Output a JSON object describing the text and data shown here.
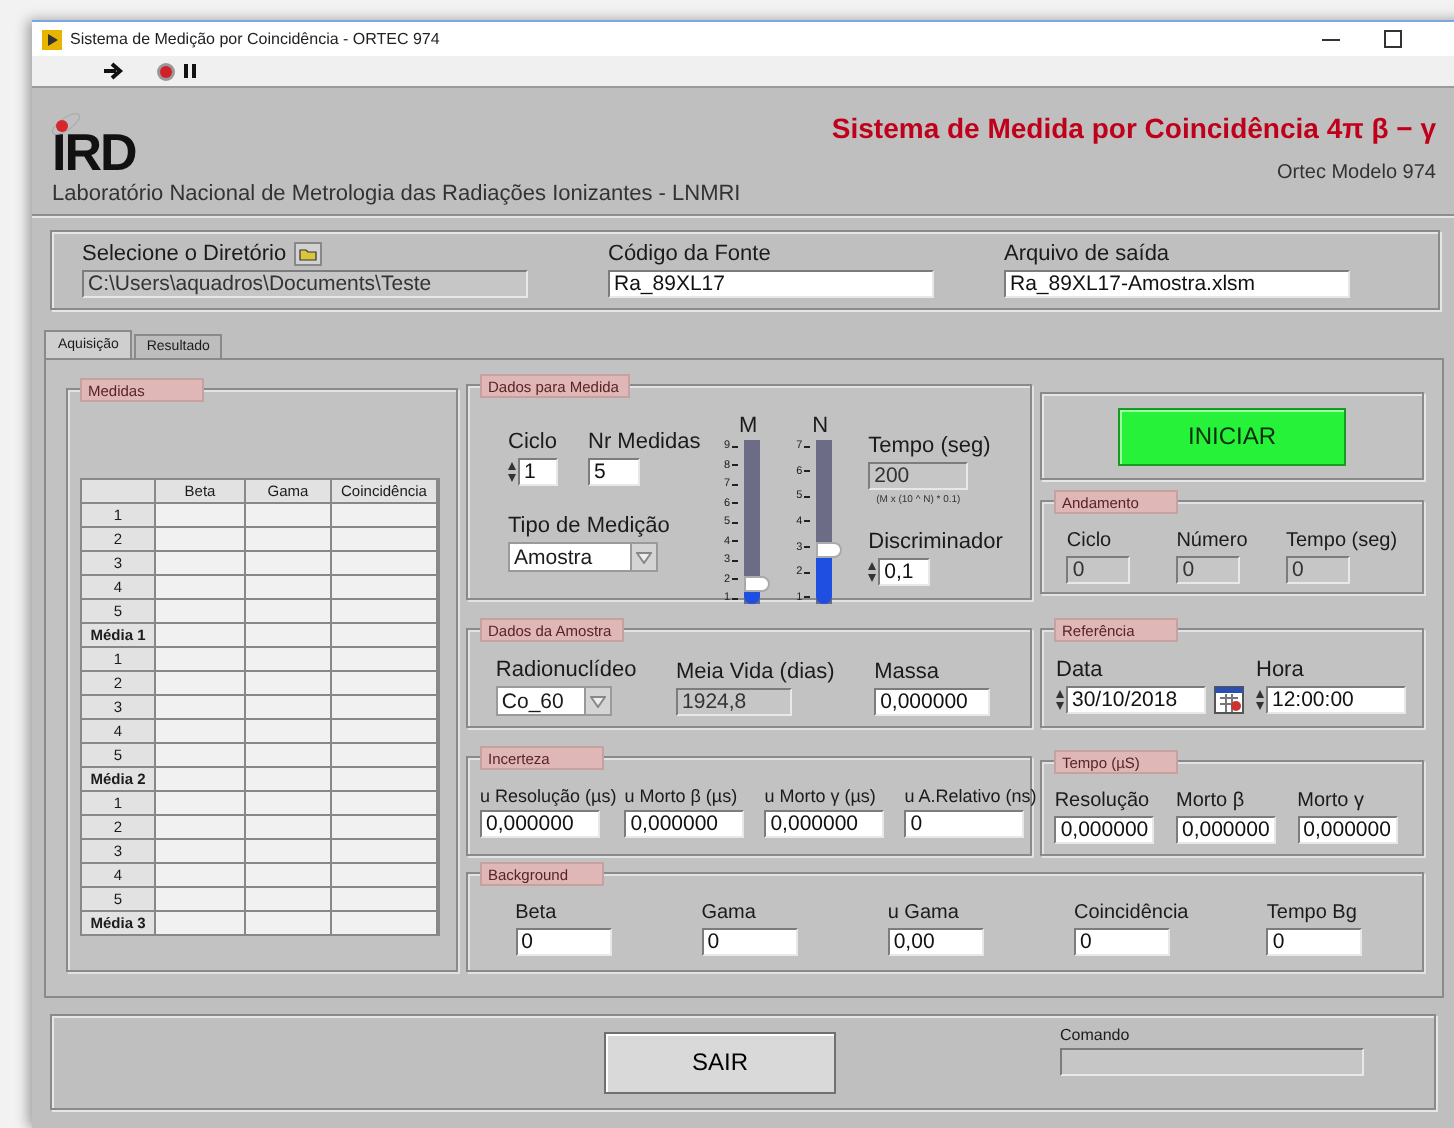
{
  "window": {
    "title": "Sistema de Medição por Coincidência - ORTEC 974"
  },
  "header": {
    "logo": "IRD",
    "lab": "Laboratório Nacional de Metrologia das Radiações Ionizantes - LNMRI",
    "title": "Sistema de Medida por Coincidência 4π β − γ",
    "subtitle": "Ortec Modelo 974"
  },
  "files": {
    "directory": {
      "label": "Selecione o Diretório",
      "value": "C:\\Users\\aquadros\\Documents\\Teste",
      "kind": "readout"
    },
    "source": {
      "label": "Código da Fonte",
      "value": "Ra_89XL17",
      "kind": "input"
    },
    "output": {
      "label": "Arquivo de saída",
      "value": "Ra_89XL17-Amostra.xlsm",
      "kind": "input"
    }
  },
  "tabs": [
    {
      "label": "Aquisição",
      "selected": true
    },
    {
      "label": "Resultado",
      "selected": false
    }
  ],
  "medidas": {
    "title": "Medidas",
    "columns": [
      "Beta",
      "Gama",
      "Coincidência"
    ],
    "rows": [
      {
        "label": "1",
        "kind": "sample"
      },
      {
        "label": "2",
        "kind": "sample"
      },
      {
        "label": "3",
        "kind": "sample"
      },
      {
        "label": "4",
        "kind": "sample"
      },
      {
        "label": "5",
        "kind": "sample"
      },
      {
        "label": "Média 1",
        "kind": "mean"
      },
      {
        "label": "1",
        "kind": "sample"
      },
      {
        "label": "2",
        "kind": "sample"
      },
      {
        "label": "3",
        "kind": "sample"
      },
      {
        "label": "4",
        "kind": "sample"
      },
      {
        "label": "5",
        "kind": "sample"
      },
      {
        "label": "Média 2",
        "kind": "mean"
      },
      {
        "label": "1",
        "kind": "sample"
      },
      {
        "label": "2",
        "kind": "sample"
      },
      {
        "label": "3",
        "kind": "sample"
      },
      {
        "label": "4",
        "kind": "sample"
      },
      {
        "label": "5",
        "kind": "sample"
      },
      {
        "label": "Média 3",
        "kind": "mean"
      }
    ]
  },
  "dados_medida": {
    "title": "Dados para Medida",
    "ciclo": {
      "label": "Ciclo",
      "value": "1",
      "kind": "spin"
    },
    "nr_medidas": {
      "label": "Nr Medidas",
      "value": "5",
      "kind": "input"
    },
    "tipo": {
      "label": "Tipo de Medição",
      "value": "Amostra",
      "kind": "dropdown"
    },
    "sliders": [
      {
        "label": "M",
        "scale": [
          "9",
          "8",
          "7",
          "6",
          "5",
          "4",
          "3",
          "2",
          "1"
        ],
        "level": 0.125
      },
      {
        "label": "N",
        "scale": [
          "7",
          "6",
          "5",
          "4",
          "3",
          "2",
          "1"
        ],
        "level": 0.333
      }
    ],
    "tempo": {
      "label": "Tempo (seg)",
      "value": "200",
      "kind": "readout",
      "note": "(M x (10 ^ N) * 0.1)"
    },
    "discriminador": {
      "label": "Discriminador",
      "value": "0,1",
      "kind": "spin"
    }
  },
  "iniciar": {
    "label": "INICIAR"
  },
  "andamento": {
    "title": "Andamento",
    "fields": [
      {
        "label": "Ciclo",
        "value": "0",
        "kind": "readout"
      },
      {
        "label": "Número",
        "value": "0",
        "kind": "readout"
      },
      {
        "label": "Tempo (seg)",
        "value": "0",
        "kind": "readout"
      }
    ]
  },
  "amostra": {
    "title": "Dados da Amostra",
    "fields": [
      {
        "label": "Radionuclídeo",
        "value": "Co_60",
        "kind": "dropdown"
      },
      {
        "label": "Meia Vida (dias)",
        "value": "1924,8",
        "kind": "readout"
      },
      {
        "label": "Massa",
        "value": "0,000000",
        "kind": "input"
      }
    ]
  },
  "referencia": {
    "title": "Referência",
    "fields": [
      {
        "label": "Data",
        "value": "30/10/2018",
        "kind": "date"
      },
      {
        "label": "Hora",
        "value": "12:00:00",
        "kind": "spin"
      }
    ]
  },
  "incerteza": {
    "title": "Incerteza",
    "fields": [
      {
        "label": "u Resolução (µs)",
        "value": "0,000000",
        "kind": "input"
      },
      {
        "label": "u Morto β (µs)",
        "value": "0,000000",
        "kind": "input"
      },
      {
        "label": "u Morto γ (µs)",
        "value": "0,000000",
        "kind": "input"
      },
      {
        "label": "u A.Relativo (ns)",
        "value": "0",
        "kind": "input"
      }
    ]
  },
  "tempo": {
    "title": "Tempo (µS)",
    "fields": [
      {
        "label": "Resolução",
        "value": "0,000000",
        "kind": "input"
      },
      {
        "label": "Morto β",
        "value": "0,000000",
        "kind": "input"
      },
      {
        "label": "Morto γ",
        "value": "0,000000",
        "kind": "input"
      }
    ]
  },
  "background": {
    "title": "Background",
    "fields": [
      {
        "label": "Beta",
        "value": "0",
        "kind": "input"
      },
      {
        "label": "Gama",
        "value": "0",
        "kind": "input"
      },
      {
        "label": "u Gama",
        "value": "0,00",
        "kind": "input"
      },
      {
        "label": "Coincidência",
        "value": "0",
        "kind": "input"
      },
      {
        "label": "Tempo Bg",
        "value": "0",
        "kind": "input"
      }
    ]
  },
  "sair": {
    "label": "SAIR"
  },
  "comando": {
    "label": "Comando",
    "kind": "readout"
  }
}
